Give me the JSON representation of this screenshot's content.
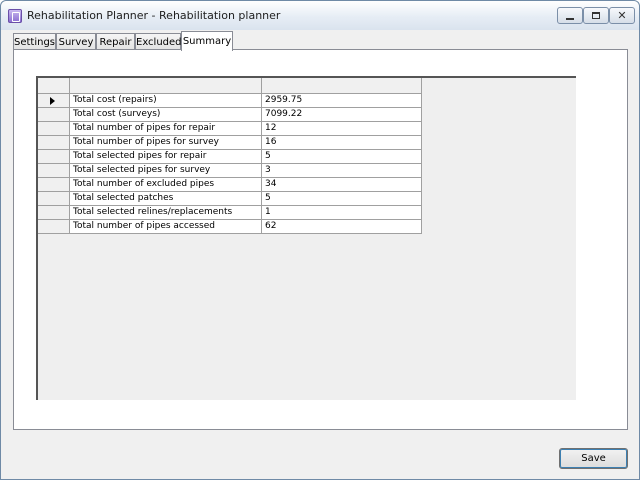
{
  "window": {
    "title": "Rehabilitation Planner - Rehabilitation planner",
    "icon": "app-icon"
  },
  "tabs": [
    {
      "label": "Settings"
    },
    {
      "label": "Survey"
    },
    {
      "label": "Repair"
    },
    {
      "label": "Excluded"
    },
    {
      "label": "Summary",
      "active": true
    }
  ],
  "summary": {
    "header": {
      "name": "",
      "value": ""
    },
    "rows": [
      {
        "name": "Total cost (repairs)",
        "value": "2959.75",
        "selected": true
      },
      {
        "name": "Total cost (surveys)",
        "value": "7099.22"
      },
      {
        "name": "Total number of pipes for repair",
        "value": "12"
      },
      {
        "name": "Total number of pipes for survey",
        "value": "16"
      },
      {
        "name": "Total selected pipes for repair",
        "value": "5"
      },
      {
        "name": "Total selected pipes for survey",
        "value": "3"
      },
      {
        "name": "Total number of excluded pipes",
        "value": "34"
      },
      {
        "name": "Total selected patches",
        "value": "5"
      },
      {
        "name": "Total selected relines/replacements",
        "value": "1"
      },
      {
        "name": "Total number of pipes accessed",
        "value": "62"
      }
    ]
  },
  "footer": {
    "save_label": "Save"
  }
}
